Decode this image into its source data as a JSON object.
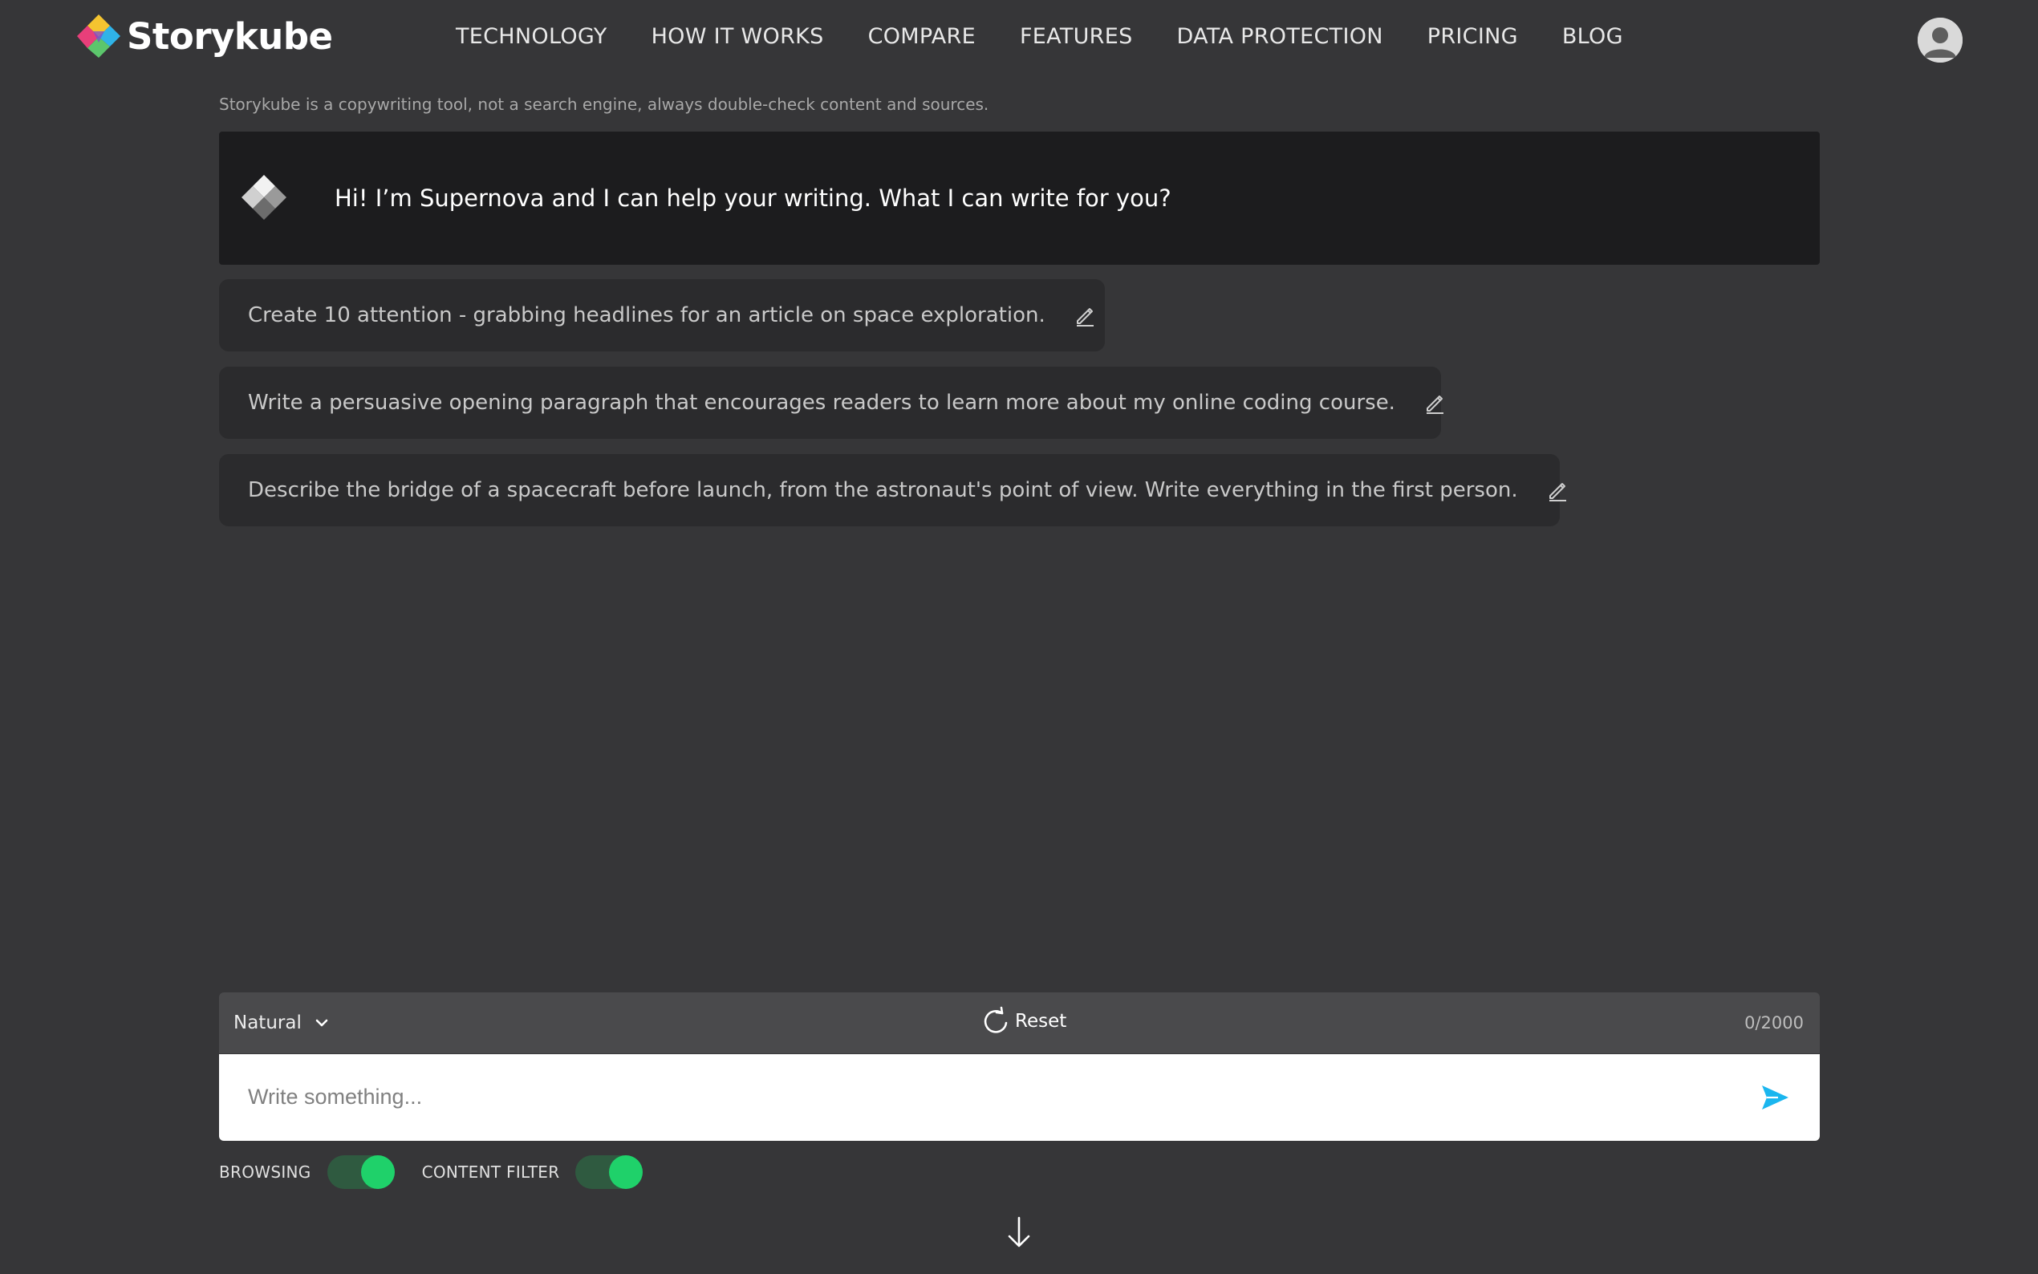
{
  "header": {
    "brand": "Storykube",
    "nav": [
      "TECHNOLOGY",
      "HOW IT WORKS",
      "COMPARE",
      "FEATURES",
      "DATA PROTECTION",
      "PRICING",
      "BLOG"
    ]
  },
  "disclaimer": "Storykube is a copywriting tool, not a search engine, always double-check content and sources.",
  "welcome": {
    "message": "Hi! I’m Supernova and I can help your writing. What I can write for you?"
  },
  "suggestions": [
    "Create 10 attention - grabbing headlines for an article on space exploration.",
    "Write a persuasive opening paragraph that encourages readers to learn more about my online coding course.",
    "Describe the bridge of a spacecraft before launch, from the astronaut's point of view. Write everything in the first person."
  ],
  "composer": {
    "mode": "Natural",
    "reset_label": "Reset",
    "counter": "0/2000",
    "placeholder": "Write something...",
    "value": ""
  },
  "toggles": {
    "browsing": {
      "label": "BROWSING",
      "on": true
    },
    "content_filter": {
      "label": "CONTENT FILTER",
      "on": true
    }
  },
  "colors": {
    "background": "#363638",
    "welcome_bg": "#1c1c1e",
    "suggestion_bg": "#2b2b2d",
    "toggle_on": "#1fd16a",
    "send_accent": "#1ab6ef"
  },
  "icons": {
    "logo": "storykube-cube-logo",
    "avatar": "user-avatar-icon",
    "assistant": "supernova-cube-icon",
    "edit": "pencil-icon",
    "mode": "chevron-down-icon",
    "reset": "refresh-icon",
    "send": "send-icon",
    "scroll": "arrow-down-icon"
  }
}
